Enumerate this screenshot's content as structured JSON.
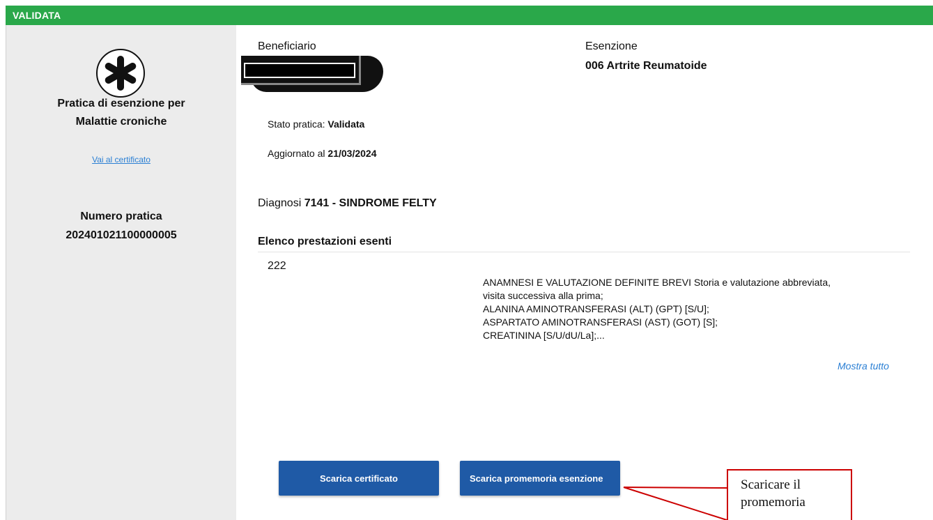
{
  "status_header": "VALIDATA",
  "sidebar": {
    "icon": "asterisk-icon",
    "title_line1": "Pratica di esenzione per",
    "title_line2": "Malattie croniche",
    "link": "Vai al certificato",
    "pratica_label": "Numero pratica",
    "pratica_number": "202401021100000005"
  },
  "beneficiario": {
    "label": "Beneficiario"
  },
  "esenzione": {
    "label": "Esenzione",
    "value": "006 Artrite Reumatoide"
  },
  "stato": {
    "label": "Stato pratica: ",
    "value": "Validata"
  },
  "aggiornato": {
    "label": "Aggiornato al ",
    "value": "21/03/2024"
  },
  "diagnosi": {
    "label": "Diagnosi ",
    "value": "7141 - SINDROME FELTY"
  },
  "prestazioni": {
    "title": "Elenco prestazioni esenti",
    "code": "222",
    "lines": [
      "ANAMNESI E VALUTAZIONE DEFINITE BREVI Storia e valutazione abbreviata,",
      "visita successiva alla prima;",
      "ALANINA AMINOTRANSFERASI (ALT) (GPT) [S/U];",
      "ASPARTATO AMINOTRANSFERASI (AST) (GOT) [S];",
      "CREATININA [S/U/dU/La];..."
    ],
    "show_all": "Mostra tutto"
  },
  "buttons": {
    "download_certificate": "Scarica certificato",
    "download_reminder": "Scarica promemoria esenzione"
  },
  "callout": {
    "line1": "Scaricare il",
    "line2": "promemoria"
  },
  "colors": {
    "header_green": "#2aa84a",
    "button_blue": "#1f5aa6",
    "link_blue": "#2a7fd4",
    "callout_red": "#cc0000"
  }
}
